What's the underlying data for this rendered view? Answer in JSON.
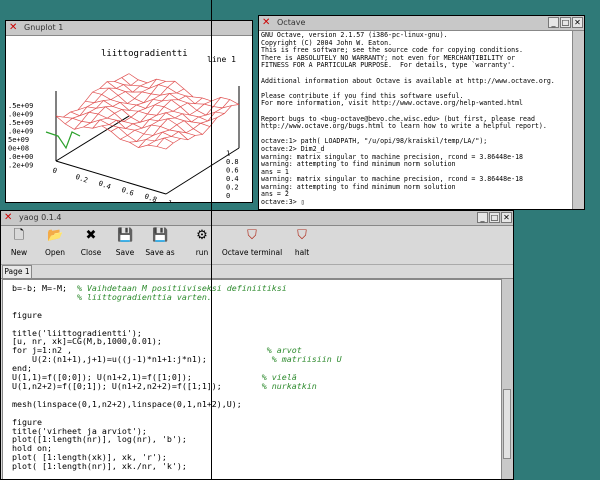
{
  "gnuplot": {
    "title": "Gnuplot 1",
    "plot_title": "liittogradientti",
    "y_ticks": [
      ".5e+09",
      ".0e+09",
      ".5e+09",
      ".0e+09",
      "5e+09",
      "0e+08",
      ".0e+00",
      ".2e+09"
    ],
    "x_ticks": [
      "0",
      "0.2",
      "0.4",
      "0.6",
      "0.8",
      "1"
    ],
    "depth_ticks": [
      "0",
      "0.2",
      "0.4",
      "0.6",
      "0.8",
      "1"
    ],
    "mesh_color": "#e05050",
    "shadow_color": "#2aa02a"
  },
  "octave": {
    "title": "Octave",
    "lines": [
      "GNU Octave, version 2.1.57 (i386-pc-linux-gnu).",
      "Copyright (C) 2004 John W. Eaton.",
      "This is free software; see the source code for copying conditions.",
      "There is ABSOLUTELY NO WARRANTY; not even for MERCHANTIBILITY or",
      "FITNESS FOR A PARTICULAR PURPOSE.  For details, type `warranty'.",
      "",
      "Additional information about Octave is available at http://www.octave.org.",
      "",
      "Please contribute if you find this software useful.",
      "For more information, visit http://www.octave.org/help-wanted.html",
      "",
      "Report bugs to <bug-octave@bevo.che.wisc.edu> (but first, please read",
      "http://www.octave.org/bugs.html to learn how to write a helpful report).",
      "",
      "octave:1> path( LOADPATH, \"/u/opi/98/kraiskil/temp/LA/\");",
      "octave:2> Dim2_d",
      "warning: matrix singular to machine precision, rcond = 3.86448e-18",
      "warning: attempting to find minimum norm solution",
      "ans = 1",
      "warning: matrix singular to machine precision, rcond = 3.86448e-18",
      "warning: attempting to find minimum norm solution",
      "ans = 2",
      "octave:3> ▯"
    ],
    "line_label": "line 1"
  },
  "yaog": {
    "title": "yaog 0.1.4",
    "toolbar": {
      "new": "New",
      "open": "Open",
      "close": "Close",
      "save": "Save",
      "save_as": "Save as",
      "run": "run",
      "octave_terminal": "Octave terminal",
      "halt": "halt"
    },
    "tab_label": "Page 1",
    "code_lines": [
      {
        "code": "b=-b; M=-M;  ",
        "comment": "% Vaihdetaan M positiiviseksi definiitiksi"
      },
      {
        "code": "             ",
        "comment": "% liittogradienttia varten."
      },
      {
        "code": "",
        "comment": ""
      },
      {
        "code": "figure",
        "comment": ""
      },
      {
        "code": "",
        "comment": ""
      },
      {
        "code": "title('liittogradientti');",
        "comment": ""
      },
      {
        "code": "[u, nr, xk]=CG(M,b,1000,0.01);",
        "comment": ""
      },
      {
        "code": "for j=1:n2 ,                                       ",
        "comment": "% arvot"
      },
      {
        "code": "    U(2:(n1+1),j+1)=u((j-1)*n1+1:j*n1);             ",
        "comment": "% matriisiin U"
      },
      {
        "code": "end;",
        "comment": ""
      },
      {
        "code": "U(1,1)=f([0;0]); U(n1+2,1)=f([1;0]);              ",
        "comment": "% vielä"
      },
      {
        "code": "U(1,n2+2)=f([0;1]); U(n1+2,n2+2)=f([1;1]);        ",
        "comment": "% nurkatkin"
      },
      {
        "code": "",
        "comment": ""
      },
      {
        "code": "mesh(linspace(0,1,n2+2),linspace(0,1,n1+2),U);",
        "comment": ""
      },
      {
        "code": "",
        "comment": ""
      },
      {
        "code": "figure",
        "comment": ""
      },
      {
        "code": "title('virheet ja arviot');",
        "comment": ""
      },
      {
        "code": "plot([1:length(nr)], log(nr), 'b');",
        "comment": ""
      },
      {
        "code": "hold on;",
        "comment": ""
      },
      {
        "code": "plot( [1:length(xk)], xk, 'r');",
        "comment": ""
      },
      {
        "code": "plot( [1:length(nr)], xk./nr, 'k');",
        "comment": ""
      }
    ]
  }
}
